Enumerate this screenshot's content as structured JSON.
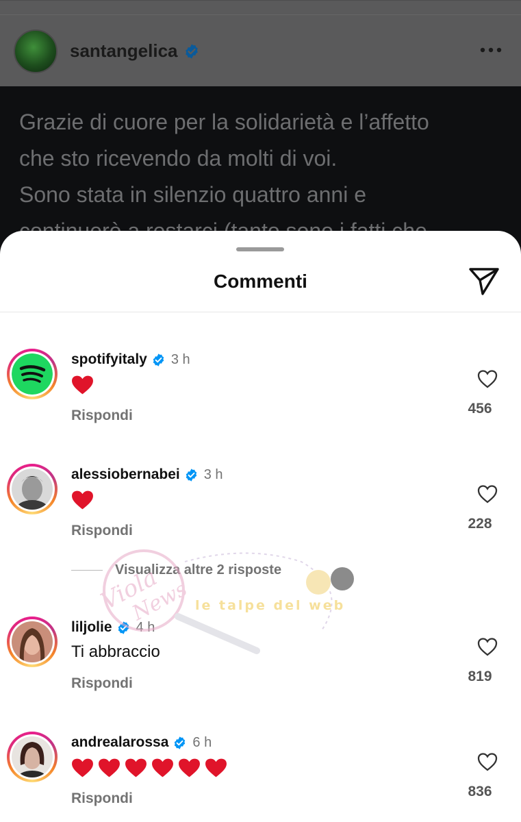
{
  "post": {
    "username": "santangelica",
    "verified": true,
    "text_lines": [
      "Grazie di cuore per la solidarietà e l’affetto",
      "che sto ricevendo da molti di voi.",
      "Sono stata in silenzio quattro anni e",
      "continuerò a restarci (tanto sono i fatti che"
    ]
  },
  "sheet": {
    "title": "Commenti"
  },
  "comments": [
    {
      "username": "spotifyitaly",
      "verified": true,
      "time": "3 h",
      "text": "",
      "hearts": 1,
      "reply_label": "Rispondi",
      "likes": "456"
    },
    {
      "username": "alessiobernabei",
      "verified": true,
      "time": "3 h",
      "text": "",
      "hearts": 1,
      "reply_label": "Rispondi",
      "likes": "228"
    },
    {
      "username": "liljolie",
      "verified": true,
      "time": "4 h",
      "text": "Ti abbraccio",
      "hearts": 0,
      "reply_label": "Rispondi",
      "likes": "819"
    },
    {
      "username": "andrealarossa",
      "verified": true,
      "time": "6 h",
      "text": "",
      "hearts": 6,
      "reply_label": "Rispondi",
      "likes": "836"
    }
  ],
  "more_replies_label": "Visualizza altre 2 risposte",
  "watermark": {
    "text_left": "Viola delle News",
    "text_right": "le talpe del web"
  },
  "colors": {
    "verified": "#0095f6",
    "heart": "#e0142a",
    "spotify": "#1ed760"
  }
}
